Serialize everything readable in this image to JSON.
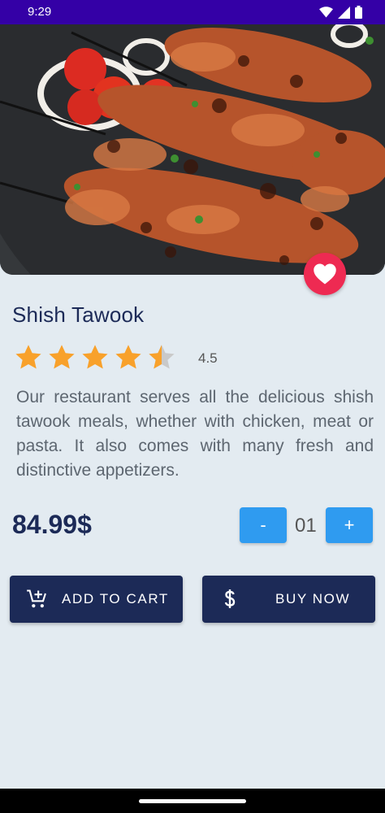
{
  "status_bar": {
    "time": "9:29"
  },
  "product": {
    "title": "Shish Tawook",
    "rating": 4.5,
    "rating_label": "4.5",
    "description": "Our restaurant serves all the delicious shish tawook meals, whether with chicken, meat or pasta. It also comes with many fresh and distinctive appetizers.",
    "price": "84.99$"
  },
  "quantity": {
    "minus_label": "-",
    "value": "01",
    "plus_label": "+"
  },
  "actions": {
    "add_to_cart": "ADD TO CART",
    "buy_now": "BUY NOW"
  },
  "colors": {
    "primary": "#1c2a57",
    "accent": "#2f9bf0",
    "favorite": "#ee2a52",
    "star": "#f8a12b",
    "status_bar": "#3400a6"
  },
  "icons": [
    "wifi-icon",
    "signal-icon",
    "battery-icon",
    "heart-icon",
    "star-icon",
    "add-cart-icon",
    "dollar-icon"
  ]
}
